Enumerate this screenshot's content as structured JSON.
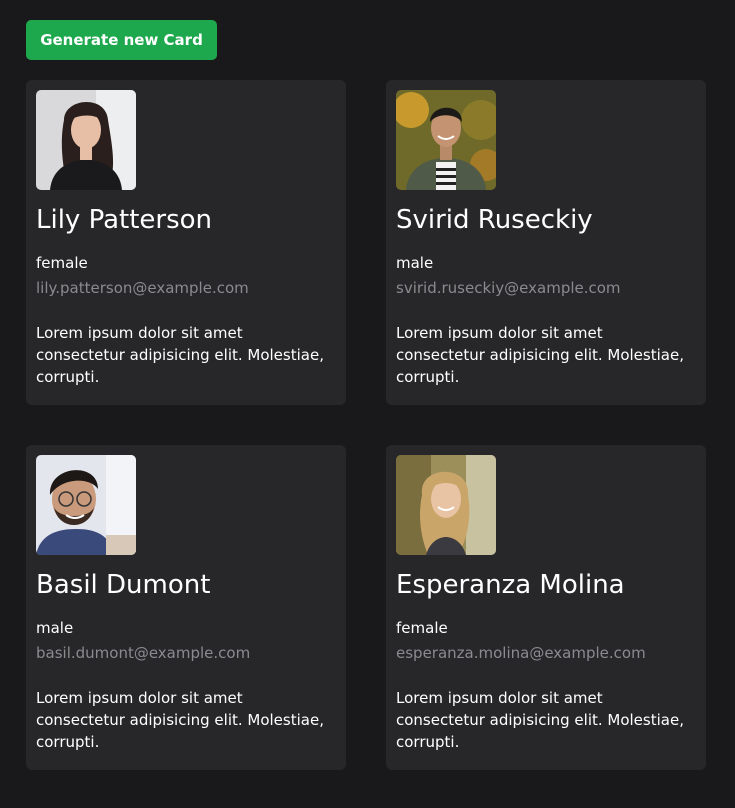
{
  "toolbar": {
    "generate_label": "Generate new Card"
  },
  "colors": {
    "background": "#19191b",
    "card": "#27272a",
    "accent": "#1ea84d",
    "email": "#8b8b8f"
  },
  "cards": [
    {
      "name": "Lily Patterson",
      "gender": "female",
      "email": "lily.patterson@example.com",
      "description": "Lorem ipsum dolor sit amet consectetur adipisicing elit. Molestiae, corrupti.",
      "avatar_icon": "avatar-photo-woman"
    },
    {
      "name": "Svirid Ruseckiy",
      "gender": "male",
      "email": "svirid.ruseckiy@example.com",
      "description": "Lorem ipsum dolor sit amet consectetur adipisicing elit. Molestiae, corrupti.",
      "avatar_icon": "avatar-photo-man"
    },
    {
      "name": "Basil Dumont",
      "gender": "male",
      "email": "basil.dumont@example.com",
      "description": "Lorem ipsum dolor sit amet consectetur adipisicing elit. Molestiae, corrupti.",
      "avatar_icon": "avatar-photo-man"
    },
    {
      "name": "Esperanza Molina",
      "gender": "female",
      "email": "esperanza.molina@example.com",
      "description": "Lorem ipsum dolor sit amet consectetur adipisicing elit. Molestiae, corrupti.",
      "avatar_icon": "avatar-photo-woman"
    }
  ]
}
